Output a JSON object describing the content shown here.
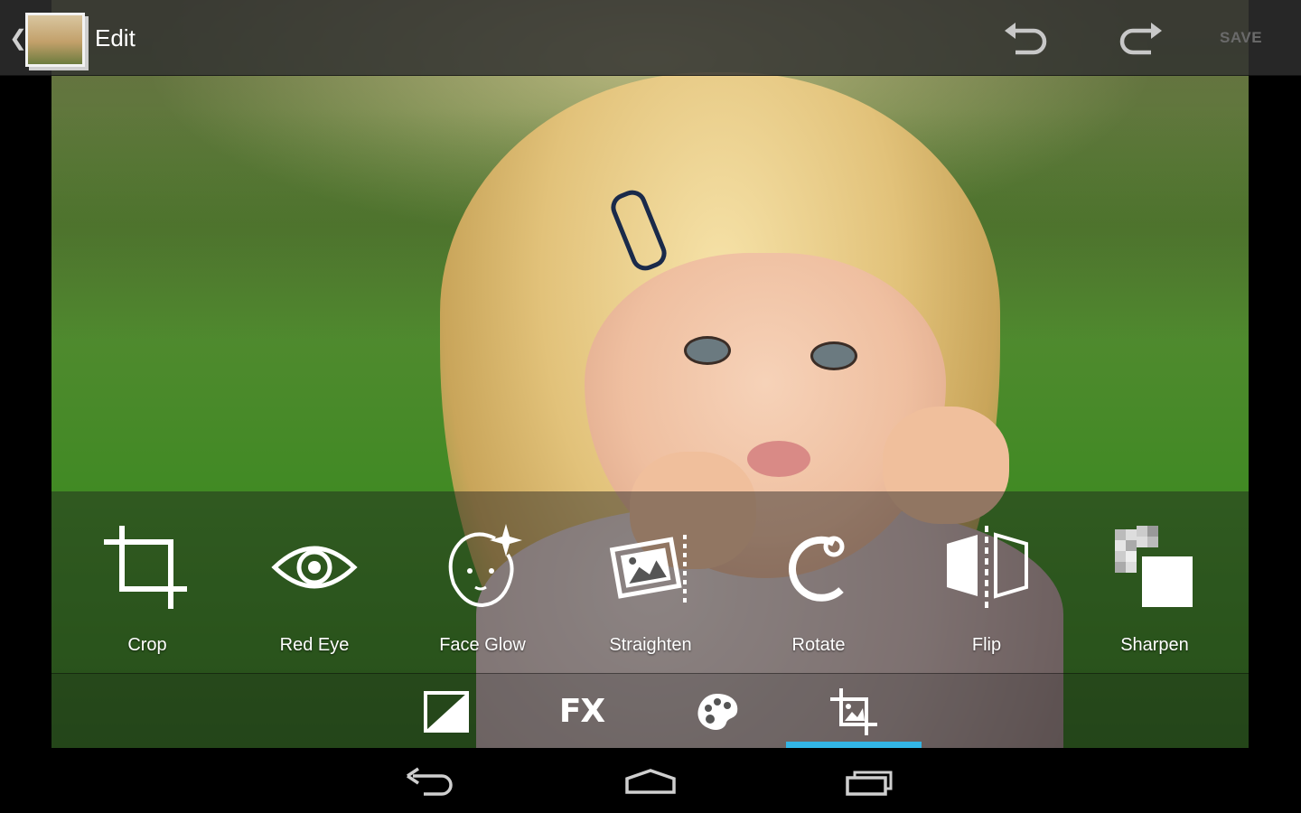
{
  "actionbar": {
    "title": "Edit",
    "save_label": "SAVE",
    "icons": {
      "app": "photo-stack-icon",
      "undo": "undo-icon",
      "redo": "redo-icon"
    }
  },
  "tools": [
    {
      "label": "Crop",
      "icon": "crop-icon"
    },
    {
      "label": "Red Eye",
      "icon": "eye-icon"
    },
    {
      "label": "Face Glow",
      "icon": "face-sparkle-icon"
    },
    {
      "label": "Straighten",
      "icon": "straighten-icon"
    },
    {
      "label": "Rotate",
      "icon": "rotate-icon"
    },
    {
      "label": "Flip",
      "icon": "flip-icon"
    },
    {
      "label": "Sharpen",
      "icon": "sharpen-icon"
    }
  ],
  "categories": {
    "fx_label": "FX",
    "items": [
      "exposure-icon",
      "fx-icon",
      "palette-icon",
      "crop-image-icon"
    ],
    "active_index": 3
  },
  "colors": {
    "accent": "#33b5e5",
    "save_disabled": "#6a6a6a"
  },
  "navbar": {
    "icons": [
      "back-icon",
      "home-icon",
      "recents-icon"
    ]
  }
}
